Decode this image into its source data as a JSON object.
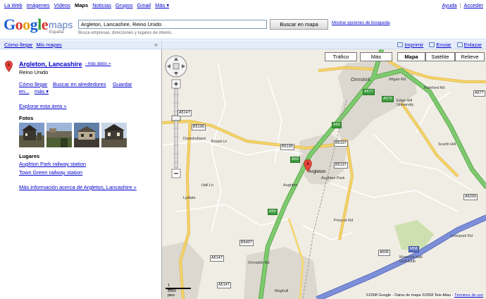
{
  "topnav": {
    "left": [
      "La Web",
      "Imágenes",
      "Vídeos",
      "Maps",
      "Noticias",
      "Grupos",
      "Gmail",
      "Más ▾"
    ],
    "active": "Maps",
    "right": [
      "Ayuda",
      "Acceder"
    ]
  },
  "logo": {
    "g": "Google",
    "maps": "maps",
    "country": "España"
  },
  "search": {
    "value": "Argleton, Lancashire, Reino Unido",
    "button": "Buscar en mapa",
    "options_link": "Mostrar opciones de búsqueda",
    "hint": "Busca empresas, direcciones y lugares de interés."
  },
  "sidebar_toolbar": {
    "directions": "Cómo llegar",
    "my_maps": "Mis mapas",
    "collapse": "«"
  },
  "place": {
    "marker": "A",
    "title": "Argleton, Lancashire",
    "more_data": "- más datos »",
    "subtitle": "Reino Unido",
    "actions": {
      "directions": "Cómo llegar",
      "search_nearby": "Buscar en alrededores",
      "save": "Guardar",
      "save_in": "en...",
      "more": "más ▾"
    },
    "explore": "Explorar esta área »",
    "photos_label": "Fotos",
    "places_label": "Lugares",
    "places": [
      "Aughton Park railway station",
      "Town Green railway station"
    ],
    "more_info": "Más información acerca de Argleton, Lancashire »"
  },
  "map_toolbar": {
    "print": "Imprimir",
    "email": "Enviar",
    "link": "Enlazar"
  },
  "map": {
    "types": [
      "Tráfico",
      "Más",
      "Mapa",
      "Satélite",
      "Relieve"
    ],
    "active_type": "Mapa",
    "pin_label": "Argleton",
    "labels": {
      "ormskirk": "Ormskirk",
      "edge_hill": "Edge Hill University",
      "scarth_hill": "Scarth Hill",
      "downholland": "Downholland",
      "aughton": "Aughton",
      "aughton_park": "Aughton Park",
      "lydiate": "Lydiate",
      "maghull": "Maghull",
      "mossock": "Mossock Hall Golf Club",
      "broad_ln": "Broad Ln",
      "wigan_rd": "Wigan Rd",
      "prescot_rd": "Prescot Rd",
      "liverpool_rd": "Liverpool Rd",
      "ormskirk_rd": "Ormskirk Rd",
      "hall_ln": "Hall Ln",
      "rainford_rd": "Rainford Rd"
    },
    "roads": {
      "a577": "A577",
      "a570": "A570",
      "a59_n": "A59",
      "a59_c": "A59",
      "a59_s": "A59",
      "a5147": "A5147",
      "b5196": "B5196",
      "b5195": "B5195",
      "b5197_a": "B5197",
      "b5197_b": "B5197",
      "b5407": "B5407",
      "a5147_s": "A5147",
      "a5147_s2": "A5147",
      "a506": "A506",
      "a5209": "A5209",
      "a577_e": "A577",
      "m58": "M58"
    },
    "scale_km": "1 km",
    "scale_ft": "2000 pies",
    "copyright": "©2008 Google - Datos de mapa ©2008 Tele Atlas -",
    "terms": "Términos de uso"
  },
  "colors": {
    "motorway": "#7d8fd8",
    "trunk": "#7ecb6f",
    "primary": "#f5d56b",
    "urban": "#d8d5cc",
    "map_bg": "#f0ede4",
    "link": "#0000cc",
    "toolbar": "#e5ecf9"
  }
}
